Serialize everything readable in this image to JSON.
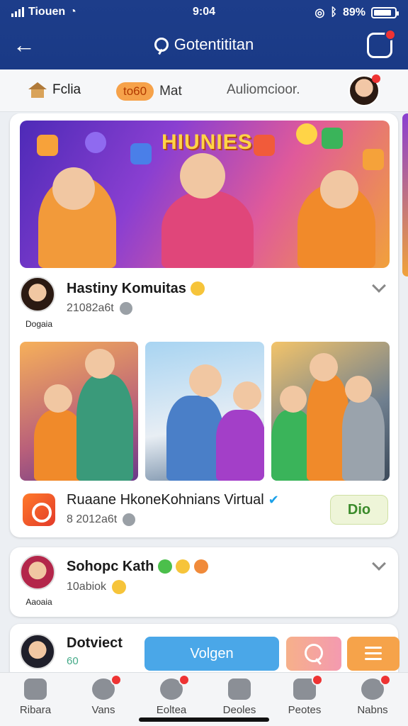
{
  "status": {
    "carrier": "Tiouen",
    "time": "9:04",
    "battery": "89%"
  },
  "header": {
    "title": "Gotentititan"
  },
  "subtabs": {
    "home": "Fclia",
    "badge": "to60",
    "badge_label": "Mat",
    "third": "Auliomcioor."
  },
  "post1": {
    "banner_title": "HIUNIES",
    "author": "Hastiny Komuitas",
    "author_caption": "Dogaia",
    "meta": "21082a6t"
  },
  "app_row": {
    "name": "Ruaane HkoneKohnians Virtual",
    "meta": "8 2012a6t",
    "button": "Dio"
  },
  "post2": {
    "author": "Sohopc Kath",
    "author_caption": "Aaoaia",
    "sub": "10abiok"
  },
  "post3": {
    "author": "Dotviect",
    "sub": "60",
    "primary_button": "Volgen"
  },
  "bottom_nav": [
    {
      "label": "Ribara",
      "icon": "home-icon",
      "badge": false
    },
    {
      "label": "Vans",
      "icon": "chat-icon",
      "badge": true
    },
    {
      "label": "Eoltea",
      "icon": "profile-icon",
      "badge": true
    },
    {
      "label": "Deoles",
      "icon": "groups-icon",
      "badge": false
    },
    {
      "label": "Peotes",
      "icon": "photos-icon",
      "badge": true
    },
    {
      "label": "Nabns",
      "icon": "notifications-icon",
      "badge": true
    }
  ],
  "colors": {
    "header": "#1a3a86",
    "primary_button": "#4aa7e8",
    "accent": "#f6a34a"
  }
}
